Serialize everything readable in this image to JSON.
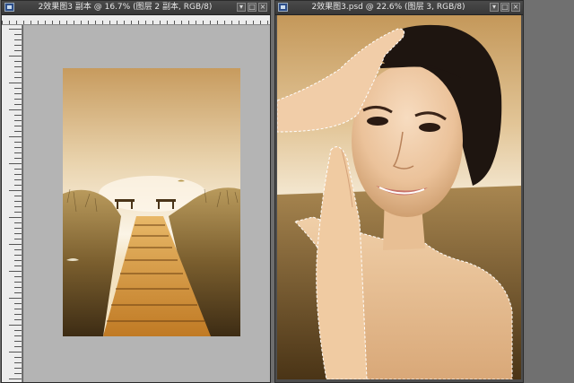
{
  "windows": {
    "left": {
      "title": "2效果图3 副本 @ 16.7% (图层 2 副本, RGB/8)"
    },
    "right": {
      "title": "2效果图3.psd @ 22.6% (图层 3, RGB/8)"
    }
  },
  "controls": {
    "minimize": "▾",
    "maximize": "□",
    "close": "×"
  },
  "colors": {
    "titlebar": "#3c3c3c",
    "canvas_gray": "#b4b4b4",
    "sky": "#f2e6cf",
    "wood": "#d69a3a"
  }
}
